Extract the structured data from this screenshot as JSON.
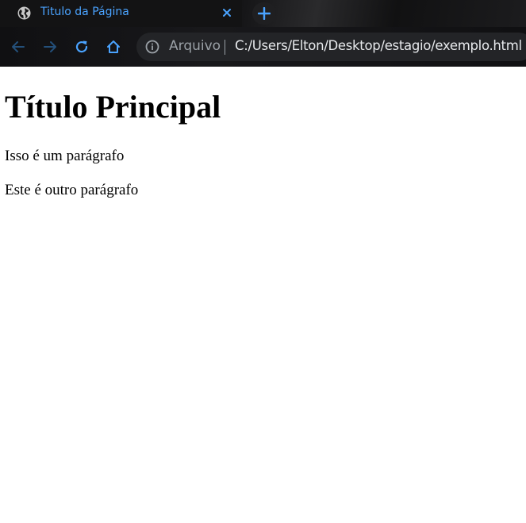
{
  "tab": {
    "title": "Titulo da Página",
    "favicon": "globe-icon",
    "close_icon": "close-icon"
  },
  "new_tab_icon": "plus-icon",
  "toolbar": {
    "back_icon": "arrow-left-icon",
    "forward_icon": "arrow-right-icon",
    "reload_icon": "reload-icon",
    "home_icon": "home-icon"
  },
  "omnibox": {
    "info_icon": "info-icon",
    "scheme_label": "Arquivo",
    "url": "C:/Users/Elton/Desktop/estagio/exemplo.html"
  },
  "page": {
    "heading": "Título Principal",
    "paragraphs": [
      "Isso é um parágrafo",
      "Este é outro parágrafo"
    ]
  },
  "colors": {
    "accent": "#4aa3ff",
    "chrome_bg": "#131314",
    "omnibox_bg": "#232427",
    "url_text": "#e8eaed",
    "muted_text": "#9aa0a6"
  }
}
